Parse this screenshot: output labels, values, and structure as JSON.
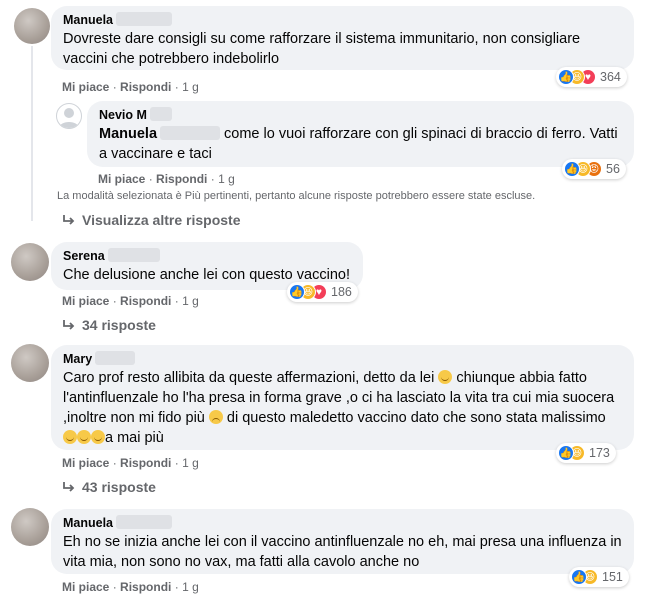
{
  "comments": [
    {
      "author": "Manuela",
      "text": "Dovreste dare consigli su come rafforzare il sistema immunitario, non consigliare vaccini che potrebbero indebolirlo",
      "actions": {
        "like": "Mi piace",
        "reply": "Rispondi",
        "time": "1 g"
      },
      "reactions": {
        "count": "364",
        "icons": [
          "like-icon",
          "haha-icon",
          "love-icon"
        ]
      }
    },
    {
      "author": "Nevio M",
      "mention": "Manuela",
      "text": "come lo vuoi rafforzare con gli spinaci di braccio di ferro. Vatti a vaccinare e taci",
      "actions": {
        "like": "Mi piace",
        "reply": "Rispondi",
        "time": "1 g"
      },
      "reactions": {
        "count": "56",
        "icons": [
          "like-icon",
          "haha-icon",
          "angry-icon"
        ]
      }
    },
    {
      "author": "Serena",
      "text": "Che delusione anche lei con questo vaccino!",
      "actions": {
        "like": "Mi piace",
        "reply": "Rispondi",
        "time": "1 g"
      },
      "reactions": {
        "count": "186",
        "icons": [
          "like-icon",
          "haha-icon",
          "love-icon"
        ]
      },
      "replies": "34 risposte"
    },
    {
      "author": "Mary",
      "text_1": "Caro prof resto allibita da queste affermazioni, detto da lei",
      "text_2": "chiunque abbia fatto l'antinfluenzale ho l'ha presa in forma grave ,o ci ha lasciato la vita tra cui mia suocera ,inoltre non mi fido più",
      "text_3": "di questo maledetto vaccino dato che sono stata malissimo",
      "text_4": "a mai più",
      "actions": {
        "like": "Mi piace",
        "reply": "Rispondi",
        "time": "1 g"
      },
      "reactions": {
        "count": "173",
        "icons": [
          "like-icon",
          "haha-icon"
        ]
      },
      "replies": "43 risposte"
    },
    {
      "author": "Manuela",
      "text": "Eh no se inizia anche lei con il vaccino antinfluenzale no eh, mai presa una influenza in vita mia, non sono no vax, ma fatti alla cavolo anche no",
      "actions": {
        "like": "Mi piace",
        "reply": "Rispondi",
        "time": "1 g"
      },
      "reactions": {
        "count": "151",
        "icons": [
          "like-icon",
          "haha-icon"
        ]
      }
    }
  ],
  "notice": "La modalità selezionata è Più pertinenti, pertanto alcune risposte potrebbero essere state escluse.",
  "more_replies": "Visualizza altre risposte",
  "separator": "·"
}
